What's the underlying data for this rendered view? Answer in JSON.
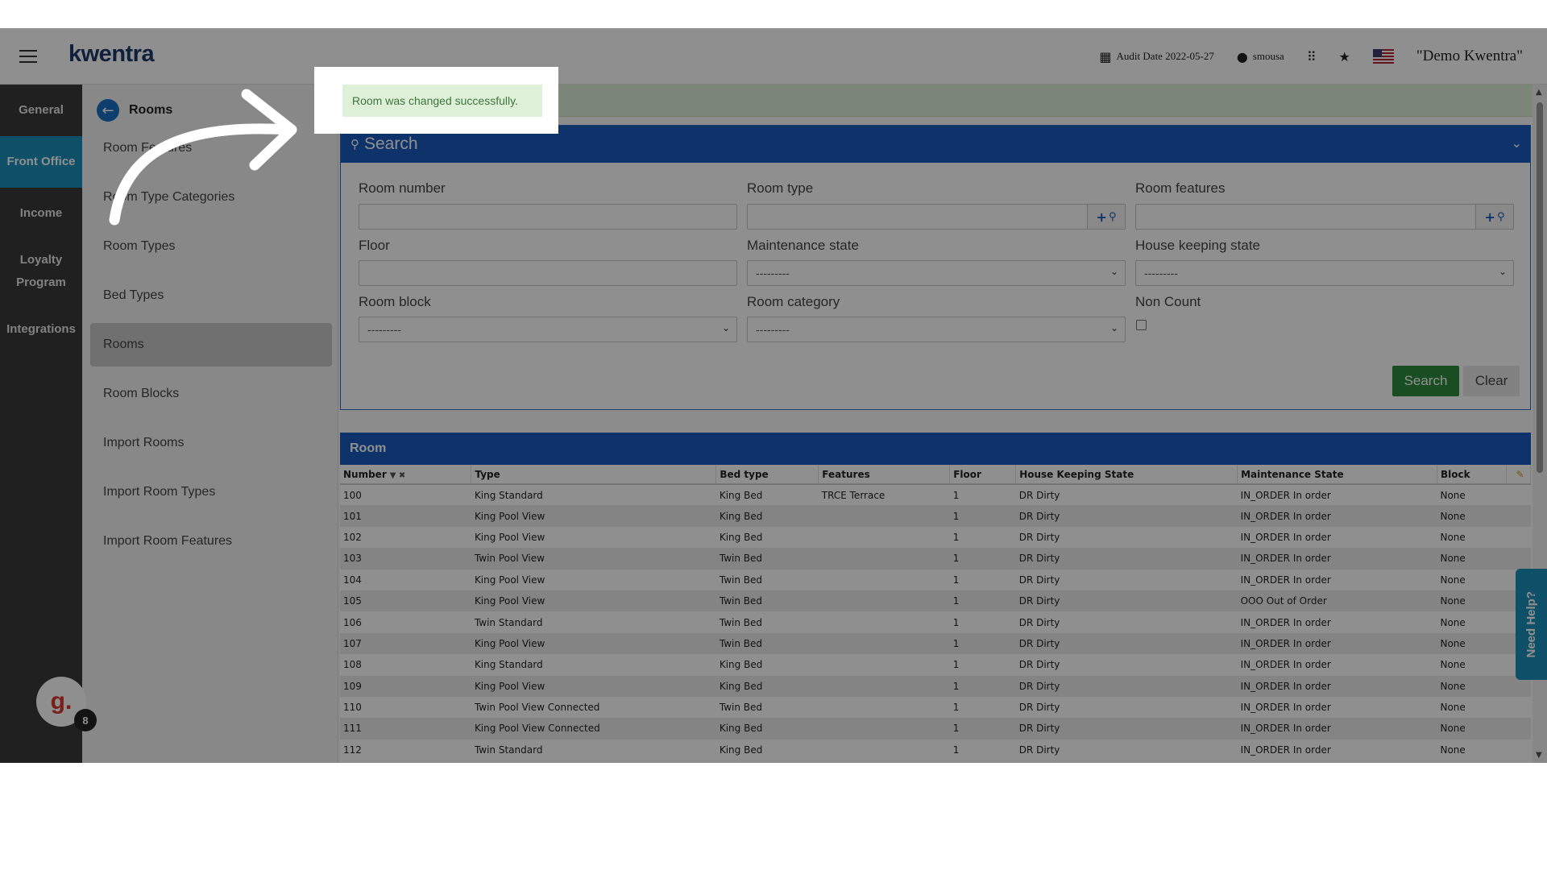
{
  "header": {
    "logo": "kwentra",
    "audit_date": "Audit Date 2022-05-27",
    "user": "smousa",
    "company": "\"Demo Kwentra\""
  },
  "rail": {
    "items": [
      {
        "label": "General"
      },
      {
        "label": "Front Office",
        "active": true
      },
      {
        "label": "Income"
      },
      {
        "label": "Loyalty Program"
      },
      {
        "label": "Integrations"
      }
    ]
  },
  "subnav": {
    "title": "Rooms",
    "items": [
      {
        "label": "Room Features"
      },
      {
        "label": "Room Type Categories"
      },
      {
        "label": "Room Types"
      },
      {
        "label": "Bed Types"
      },
      {
        "label": "Rooms",
        "active": true
      },
      {
        "label": "Room Blocks"
      },
      {
        "label": "Import Rooms"
      },
      {
        "label": "Import Room Types"
      },
      {
        "label": "Import Room Features"
      }
    ]
  },
  "alert": {
    "message": "Room was changed successfully."
  },
  "search": {
    "title": "Search",
    "labels": {
      "room_number": "Room number",
      "room_type": "Room type",
      "room_features": "Room features",
      "floor": "Floor",
      "maintenance_state": "Maintenance state",
      "house_keeping_state": "House keeping state",
      "room_block": "Room block",
      "room_category": "Room category",
      "non_count": "Non Count"
    },
    "select_placeholder": "---------",
    "search_button": "Search",
    "clear_button": "Clear"
  },
  "table": {
    "title": "Room",
    "columns": [
      "Number",
      "Type",
      "Bed type",
      "Features",
      "Floor",
      "House Keeping State",
      "Maintenance State",
      "Block"
    ],
    "rows": [
      [
        "100",
        "King Standard",
        "King Bed",
        "TRCE Terrace",
        "1",
        "DR Dirty",
        "IN_ORDER In order",
        "None"
      ],
      [
        "101",
        "King Pool View",
        "King Bed",
        "",
        "1",
        "DR Dirty",
        "IN_ORDER In order",
        "None"
      ],
      [
        "102",
        "King Pool View",
        "King Bed",
        "",
        "1",
        "DR Dirty",
        "IN_ORDER In order",
        "None"
      ],
      [
        "103",
        "Twin Pool View",
        "Twin Bed",
        "",
        "1",
        "DR Dirty",
        "IN_ORDER In order",
        "None"
      ],
      [
        "104",
        "King Pool View",
        "Twin Bed",
        "",
        "1",
        "DR Dirty",
        "IN_ORDER In order",
        "None"
      ],
      [
        "105",
        "King Pool View",
        "Twin Bed",
        "",
        "1",
        "DR Dirty",
        "OOO Out of Order",
        "None"
      ],
      [
        "106",
        "Twin Standard",
        "Twin Bed",
        "",
        "1",
        "DR Dirty",
        "IN_ORDER In order",
        "None"
      ],
      [
        "107",
        "King Pool View",
        "Twin Bed",
        "",
        "1",
        "DR Dirty",
        "IN_ORDER In order",
        "None"
      ],
      [
        "108",
        "King Standard",
        "King Bed",
        "",
        "1",
        "DR Dirty",
        "IN_ORDER In order",
        "None"
      ],
      [
        "109",
        "King Pool View",
        "King Bed",
        "",
        "1",
        "DR Dirty",
        "IN_ORDER In order",
        "None"
      ],
      [
        "110",
        "Twin Pool View Connected",
        "Twin Bed",
        "",
        "1",
        "DR Dirty",
        "IN_ORDER In order",
        "None"
      ],
      [
        "111",
        "King Pool View Connected",
        "King Bed",
        "",
        "1",
        "DR Dirty",
        "IN_ORDER In order",
        "None"
      ],
      [
        "112",
        "Twin Standard",
        "King Bed",
        "",
        "1",
        "DR Dirty",
        "IN_ORDER In order",
        "None"
      ]
    ]
  },
  "help_tab": "Need Help?",
  "widget": {
    "logo": "g.",
    "badge": "8"
  }
}
